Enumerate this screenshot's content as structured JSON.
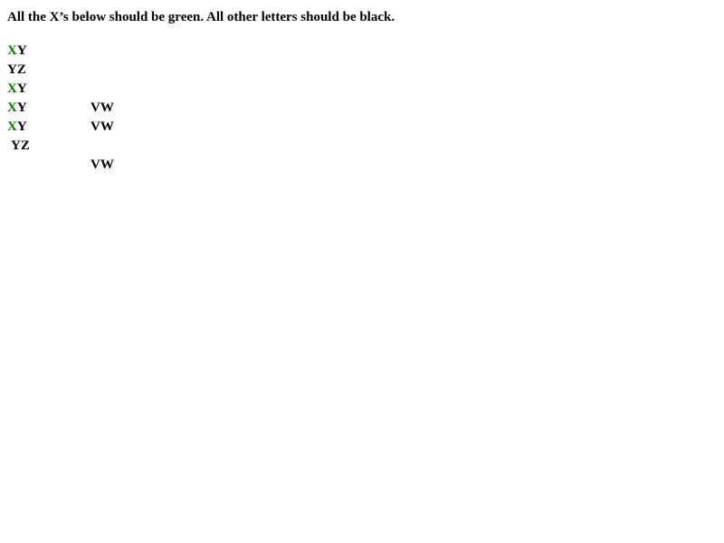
{
  "instruction": "All the X’s below should be green. All other letters should be black.",
  "colors": {
    "x_color": "#008000",
    "other_color": "#000000"
  },
  "rows": [
    {
      "x": "X",
      "y": "Y"
    },
    {
      "y": "Y",
      "z": "Z"
    },
    {
      "x": "X",
      "y": "Y"
    },
    {
      "x": "X",
      "y": "Y",
      "v": "V",
      "w": "W"
    },
    {
      "x": "X",
      "y": "Y",
      "v": "V",
      "w": "W"
    },
    {
      "y": "Y",
      "z": "Z"
    },
    {
      "v": "V",
      "w": "W"
    }
  ]
}
